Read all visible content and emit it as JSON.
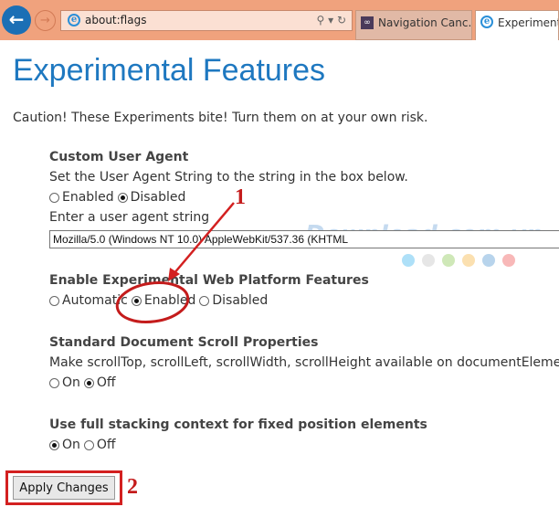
{
  "browser": {
    "address": "about:flags",
    "tabs": [
      {
        "label": "Navigation Canc..."
      },
      {
        "label": "Experimental"
      }
    ]
  },
  "page": {
    "title": "Experimental Features",
    "caution": "Caution! These Experiments bite! Turn them on at your own risk.",
    "sections": [
      {
        "title": "Custom User Agent",
        "desc": "Set the User Agent String to the string in the box below.",
        "options": [
          {
            "label": "Enabled",
            "checked": false
          },
          {
            "label": "Disabled",
            "checked": true
          }
        ],
        "input_label": "Enter a user agent string",
        "input_value": "Mozilla/5.0 (Windows NT 10.0) AppleWebKit/537.36 (KHTML"
      },
      {
        "title": "Enable Experimental Web Platform Features",
        "options": [
          {
            "label": "Automatic",
            "checked": false
          },
          {
            "label": "Enabled",
            "checked": true
          },
          {
            "label": "Disabled",
            "checked": false
          }
        ]
      },
      {
        "title": "Standard Document Scroll Properties",
        "desc": "Make scrollTop, scrollLeft, scrollWidth, scrollHeight available on documentElement",
        "options": [
          {
            "label": "On",
            "checked": false
          },
          {
            "label": "Off",
            "checked": true
          }
        ]
      },
      {
        "title": "Use full stacking context for fixed position elements",
        "options": [
          {
            "label": "On",
            "checked": true
          },
          {
            "label": "Off",
            "checked": false
          }
        ]
      }
    ],
    "apply_label": "Apply Changes"
  },
  "annotations": {
    "step1": "1",
    "step2": "2",
    "accent": "#d32020"
  },
  "watermark": "Download.com.vn"
}
